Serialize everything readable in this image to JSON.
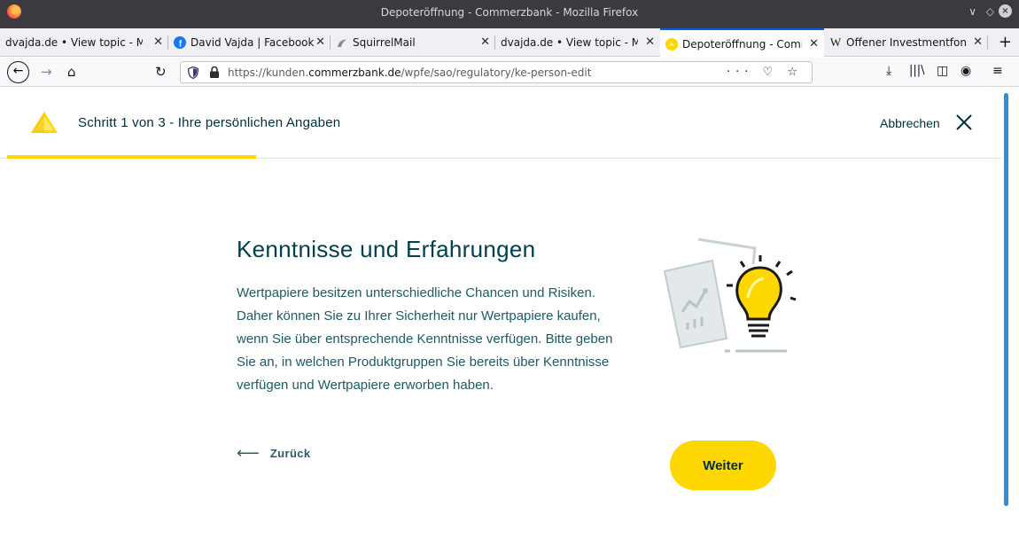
{
  "window": {
    "title": "Depoteröffnung - Commerzbank - Mozilla Firefox",
    "controls": [
      "∨",
      "◇",
      "×"
    ]
  },
  "tabs": [
    {
      "label": "dvajda.de • View topic - Ma",
      "active": false
    },
    {
      "label": "David Vajda | Facebook",
      "active": false
    },
    {
      "label": "SquirrelMail",
      "active": false
    },
    {
      "label": "dvajda.de • View topic - Ma",
      "active": false
    },
    {
      "label": "Depoteröffnung - Comr",
      "active": true
    },
    {
      "label": "Offener Investmentfon",
      "active": false
    }
  ],
  "new_tab": "+",
  "navbar": {
    "url_prefix": "https://kunden.",
    "url_domain": "commerzbank.de",
    "url_path": "/wpfe/sao/regulatory/ke-person-edit",
    "url_actions": "··· ♡ ☆"
  },
  "page": {
    "step_title": "Schritt 1 von 3 - Ihre persönlichen Angaben",
    "step_progress": 0.25,
    "cancel_label": "Abbrechen",
    "headline": "Kenntnisse und Erfahrungen",
    "body": "Wertpapiere besitzen unterschiedliche Chancen und Risiken. Daher können Sie zu Ihrer Sicherheit nur Wertpapiere kaufen, wenn Sie über entsprechende Kenntnisse verfügen. Bitte geben Sie an, in welchen Produktgruppen Sie bereits über Kenntnisse verfügen und Wertpapiere erworben haben.",
    "back_label": "Zurück",
    "next_label": "Weiter"
  },
  "colors": {
    "brand_yellow": "#ffd700",
    "text_dark": "#002e3c",
    "accent_blue": "#0061e0"
  }
}
